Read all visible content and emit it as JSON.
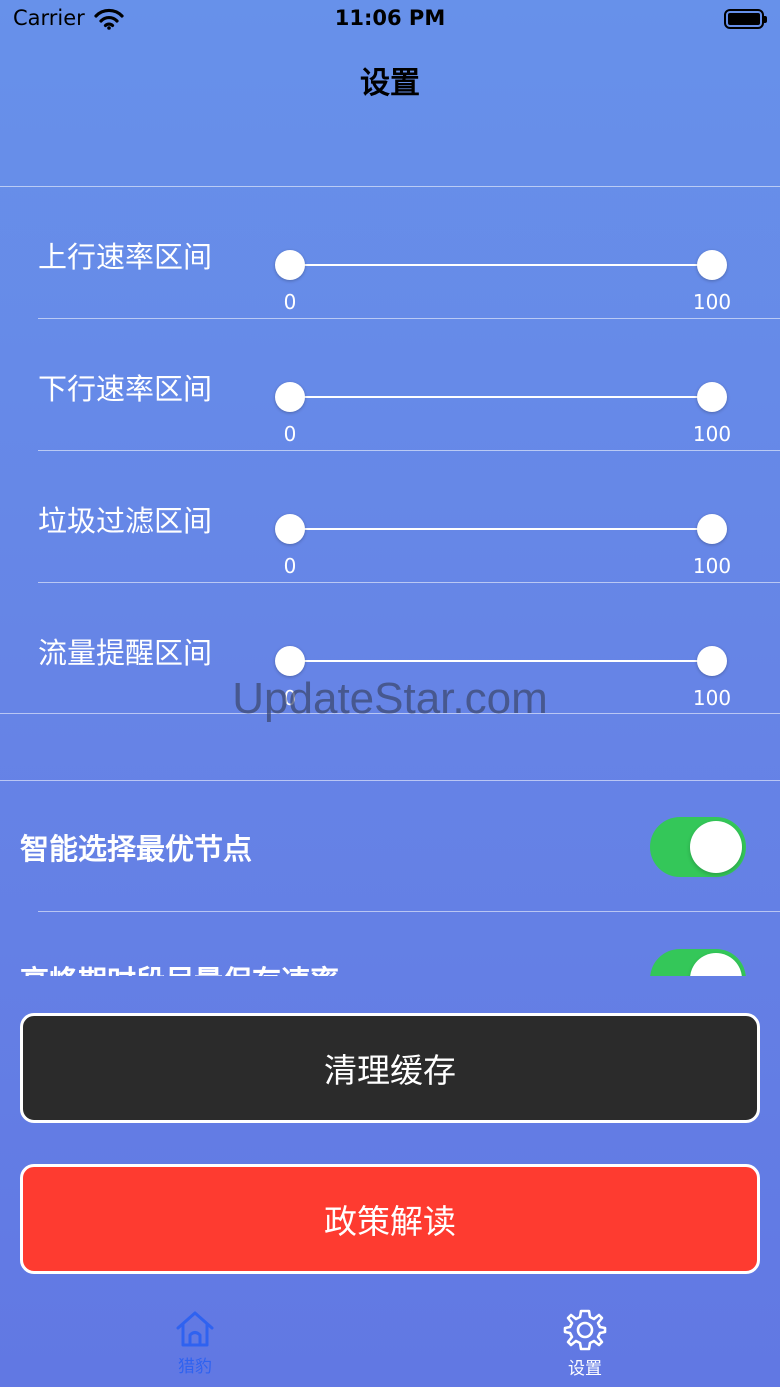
{
  "status_bar": {
    "carrier": "Carrier",
    "time": "11:06 PM"
  },
  "nav": {
    "title": "设置"
  },
  "sliders": [
    {
      "label": "上行速率区间",
      "min_label": "0",
      "max_label": "100"
    },
    {
      "label": "下行速率区间",
      "min_label": "0",
      "max_label": "100"
    },
    {
      "label": "垃圾过滤区间",
      "min_label": "0",
      "max_label": "100"
    },
    {
      "label": "流量提醒区间",
      "min_label": "0",
      "max_label": "100"
    }
  ],
  "toggles": [
    {
      "label": "智能选择最优节点",
      "on": true
    },
    {
      "label": "高峰期时段尽量保存速率",
      "on": true
    }
  ],
  "buttons": {
    "clear_cache": "清理缓存",
    "policy": "政策解读"
  },
  "tabs": [
    {
      "label": "猎豹",
      "icon": "home-icon",
      "active": true
    },
    {
      "label": "设置",
      "icon": "gear-icon",
      "active": false
    }
  ],
  "watermark": "UpdateStar.com",
  "colors": {
    "toggle_on": "#34c759",
    "clear_button": "#2b2b2b",
    "policy_button": "#fe3b30",
    "active_tab": "#2f62f0"
  }
}
